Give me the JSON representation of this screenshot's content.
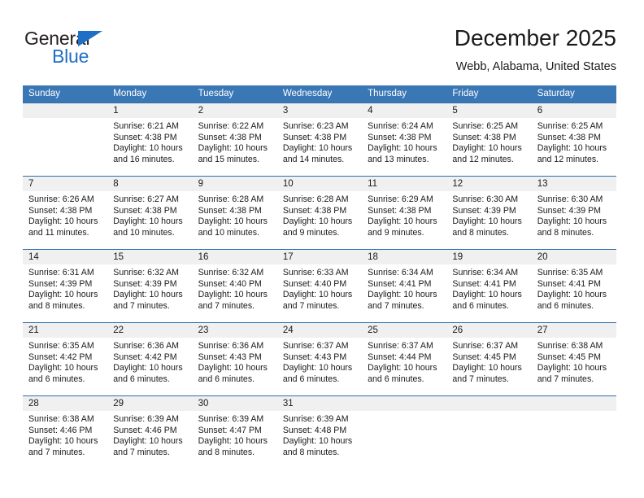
{
  "brand": {
    "name_dark": "General",
    "name_blue": "Blue",
    "accent_color": "#1f6fc4"
  },
  "header": {
    "title": "December 2025",
    "location": "Webb, Alabama, United States"
  },
  "theme": {
    "header_row_blue": "#3a77b5",
    "row_divider_blue": "#2f6fae",
    "daynum_strip_gray": "#f0f0f0"
  },
  "weekday_headers": [
    "Sunday",
    "Monday",
    "Tuesday",
    "Wednesday",
    "Thursday",
    "Friday",
    "Saturday"
  ],
  "weeks": [
    [
      {
        "day": "",
        "sunrise": "",
        "sunset": "",
        "daylight": ""
      },
      {
        "day": "1",
        "sunrise": "Sunrise: 6:21 AM",
        "sunset": "Sunset: 4:38 PM",
        "daylight": "Daylight: 10 hours and 16 minutes."
      },
      {
        "day": "2",
        "sunrise": "Sunrise: 6:22 AM",
        "sunset": "Sunset: 4:38 PM",
        "daylight": "Daylight: 10 hours and 15 minutes."
      },
      {
        "day": "3",
        "sunrise": "Sunrise: 6:23 AM",
        "sunset": "Sunset: 4:38 PM",
        "daylight": "Daylight: 10 hours and 14 minutes."
      },
      {
        "day": "4",
        "sunrise": "Sunrise: 6:24 AM",
        "sunset": "Sunset: 4:38 PM",
        "daylight": "Daylight: 10 hours and 13 minutes."
      },
      {
        "day": "5",
        "sunrise": "Sunrise: 6:25 AM",
        "sunset": "Sunset: 4:38 PM",
        "daylight": "Daylight: 10 hours and 12 minutes."
      },
      {
        "day": "6",
        "sunrise": "Sunrise: 6:25 AM",
        "sunset": "Sunset: 4:38 PM",
        "daylight": "Daylight: 10 hours and 12 minutes."
      }
    ],
    [
      {
        "day": "7",
        "sunrise": "Sunrise: 6:26 AM",
        "sunset": "Sunset: 4:38 PM",
        "daylight": "Daylight: 10 hours and 11 minutes."
      },
      {
        "day": "8",
        "sunrise": "Sunrise: 6:27 AM",
        "sunset": "Sunset: 4:38 PM",
        "daylight": "Daylight: 10 hours and 10 minutes."
      },
      {
        "day": "9",
        "sunrise": "Sunrise: 6:28 AM",
        "sunset": "Sunset: 4:38 PM",
        "daylight": "Daylight: 10 hours and 10 minutes."
      },
      {
        "day": "10",
        "sunrise": "Sunrise: 6:28 AM",
        "sunset": "Sunset: 4:38 PM",
        "daylight": "Daylight: 10 hours and 9 minutes."
      },
      {
        "day": "11",
        "sunrise": "Sunrise: 6:29 AM",
        "sunset": "Sunset: 4:38 PM",
        "daylight": "Daylight: 10 hours and 9 minutes."
      },
      {
        "day": "12",
        "sunrise": "Sunrise: 6:30 AM",
        "sunset": "Sunset: 4:39 PM",
        "daylight": "Daylight: 10 hours and 8 minutes."
      },
      {
        "day": "13",
        "sunrise": "Sunrise: 6:30 AM",
        "sunset": "Sunset: 4:39 PM",
        "daylight": "Daylight: 10 hours and 8 minutes."
      }
    ],
    [
      {
        "day": "14",
        "sunrise": "Sunrise: 6:31 AM",
        "sunset": "Sunset: 4:39 PM",
        "daylight": "Daylight: 10 hours and 8 minutes."
      },
      {
        "day": "15",
        "sunrise": "Sunrise: 6:32 AM",
        "sunset": "Sunset: 4:39 PM",
        "daylight": "Daylight: 10 hours and 7 minutes."
      },
      {
        "day": "16",
        "sunrise": "Sunrise: 6:32 AM",
        "sunset": "Sunset: 4:40 PM",
        "daylight": "Daylight: 10 hours and 7 minutes."
      },
      {
        "day": "17",
        "sunrise": "Sunrise: 6:33 AM",
        "sunset": "Sunset: 4:40 PM",
        "daylight": "Daylight: 10 hours and 7 minutes."
      },
      {
        "day": "18",
        "sunrise": "Sunrise: 6:34 AM",
        "sunset": "Sunset: 4:41 PM",
        "daylight": "Daylight: 10 hours and 7 minutes."
      },
      {
        "day": "19",
        "sunrise": "Sunrise: 6:34 AM",
        "sunset": "Sunset: 4:41 PM",
        "daylight": "Daylight: 10 hours and 6 minutes."
      },
      {
        "day": "20",
        "sunrise": "Sunrise: 6:35 AM",
        "sunset": "Sunset: 4:41 PM",
        "daylight": "Daylight: 10 hours and 6 minutes."
      }
    ],
    [
      {
        "day": "21",
        "sunrise": "Sunrise: 6:35 AM",
        "sunset": "Sunset: 4:42 PM",
        "daylight": "Daylight: 10 hours and 6 minutes."
      },
      {
        "day": "22",
        "sunrise": "Sunrise: 6:36 AM",
        "sunset": "Sunset: 4:42 PM",
        "daylight": "Daylight: 10 hours and 6 minutes."
      },
      {
        "day": "23",
        "sunrise": "Sunrise: 6:36 AM",
        "sunset": "Sunset: 4:43 PM",
        "daylight": "Daylight: 10 hours and 6 minutes."
      },
      {
        "day": "24",
        "sunrise": "Sunrise: 6:37 AM",
        "sunset": "Sunset: 4:43 PM",
        "daylight": "Daylight: 10 hours and 6 minutes."
      },
      {
        "day": "25",
        "sunrise": "Sunrise: 6:37 AM",
        "sunset": "Sunset: 4:44 PM",
        "daylight": "Daylight: 10 hours and 6 minutes."
      },
      {
        "day": "26",
        "sunrise": "Sunrise: 6:37 AM",
        "sunset": "Sunset: 4:45 PM",
        "daylight": "Daylight: 10 hours and 7 minutes."
      },
      {
        "day": "27",
        "sunrise": "Sunrise: 6:38 AM",
        "sunset": "Sunset: 4:45 PM",
        "daylight": "Daylight: 10 hours and 7 minutes."
      }
    ],
    [
      {
        "day": "28",
        "sunrise": "Sunrise: 6:38 AM",
        "sunset": "Sunset: 4:46 PM",
        "daylight": "Daylight: 10 hours and 7 minutes."
      },
      {
        "day": "29",
        "sunrise": "Sunrise: 6:39 AM",
        "sunset": "Sunset: 4:46 PM",
        "daylight": "Daylight: 10 hours and 7 minutes."
      },
      {
        "day": "30",
        "sunrise": "Sunrise: 6:39 AM",
        "sunset": "Sunset: 4:47 PM",
        "daylight": "Daylight: 10 hours and 8 minutes."
      },
      {
        "day": "31",
        "sunrise": "Sunrise: 6:39 AM",
        "sunset": "Sunset: 4:48 PM",
        "daylight": "Daylight: 10 hours and 8 minutes."
      },
      {
        "day": "",
        "sunrise": "",
        "sunset": "",
        "daylight": ""
      },
      {
        "day": "",
        "sunrise": "",
        "sunset": "",
        "daylight": ""
      },
      {
        "day": "",
        "sunrise": "",
        "sunset": "",
        "daylight": ""
      }
    ]
  ]
}
